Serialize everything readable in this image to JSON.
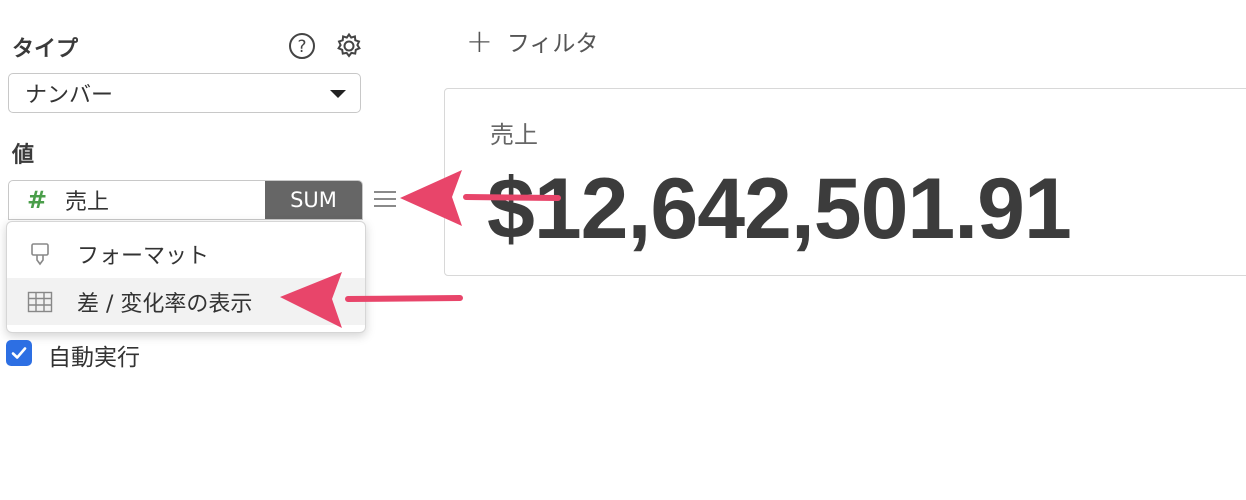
{
  "sidebar": {
    "type_label": "タイプ",
    "type_select_value": "ナンバー",
    "value_label": "値",
    "field": {
      "icon": "#",
      "name": "売上",
      "aggregation": "SUM"
    },
    "menu_items": [
      {
        "icon": "format-brush-icon",
        "label": "フォーマット"
      },
      {
        "icon": "table-grid-icon",
        "label": "差 / 変化率の表示"
      }
    ],
    "auto_run": {
      "label": "自動実行",
      "checked": true
    }
  },
  "toolbar": {
    "filter_label": "フィルタ"
  },
  "card": {
    "title": "売上",
    "value": "$12,642,501.91"
  },
  "colors": {
    "accent_arrow": "#e8456a",
    "checkbox": "#2d6fe3",
    "agg_bg": "#666666",
    "hash": "#4a9e4a"
  }
}
